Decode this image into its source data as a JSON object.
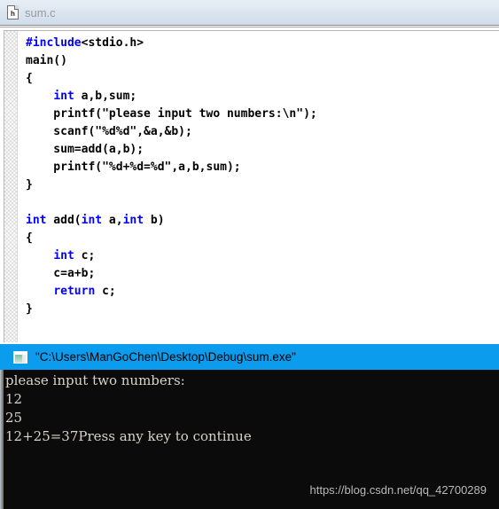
{
  "tab": {
    "label": "sum.c",
    "icon": "file-h-icon",
    "icon_letter": "h"
  },
  "editor": {
    "language": "c",
    "keyword_color": "#0000ff",
    "text_color": "#000000",
    "background": "#ffffff",
    "lines": [
      [
        {
          "t": "#include",
          "k": true
        },
        {
          "t": "<stdio.h>",
          "k": false
        }
      ],
      [
        {
          "t": "main()",
          "k": false
        }
      ],
      [
        {
          "t": "{",
          "k": false
        }
      ],
      [
        {
          "t": "    ",
          "k": false
        },
        {
          "t": "int",
          "k": true
        },
        {
          "t": " a,b,sum;",
          "k": false
        }
      ],
      [
        {
          "t": "    printf(\"please input two numbers:\\n\");",
          "k": false
        }
      ],
      [
        {
          "t": "    scanf(\"%d%d\",&a,&b);",
          "k": false
        }
      ],
      [
        {
          "t": "    sum=add(a,b);",
          "k": false
        }
      ],
      [
        {
          "t": "    printf(\"%d+%d=%d\",a,b,sum);",
          "k": false
        }
      ],
      [
        {
          "t": "}",
          "k": false
        }
      ],
      [
        {
          "t": "",
          "k": false
        }
      ],
      [
        {
          "t": "int",
          "k": true
        },
        {
          "t": " add(",
          "k": false
        },
        {
          "t": "int",
          "k": true
        },
        {
          "t": " a,",
          "k": false
        },
        {
          "t": "int",
          "k": true
        },
        {
          "t": " b)",
          "k": false
        }
      ],
      [
        {
          "t": "{",
          "k": false
        }
      ],
      [
        {
          "t": "    ",
          "k": false
        },
        {
          "t": "int",
          "k": true
        },
        {
          "t": " c;",
          "k": false
        }
      ],
      [
        {
          "t": "    c=a+b;",
          "k": false
        }
      ],
      [
        {
          "t": "    ",
          "k": false
        },
        {
          "t": "return",
          "k": true
        },
        {
          "t": " c;",
          "k": false
        }
      ],
      [
        {
          "t": "}",
          "k": false
        }
      ]
    ]
  },
  "console": {
    "titlebar_color": "#0c9ced",
    "title": "\"C:\\Users\\ManGoChen\\Desktop\\Debug\\sum.exe\"",
    "icon": "console-window-icon",
    "background": "#0b0b0b",
    "text_color": "#d6d3c8",
    "output_lines": [
      "please input two numbers:",
      "12",
      "25",
      "12+25=37Press any key to continue"
    ]
  },
  "watermark": {
    "text": "https://blog.csdn.net/qq_42700289"
  }
}
